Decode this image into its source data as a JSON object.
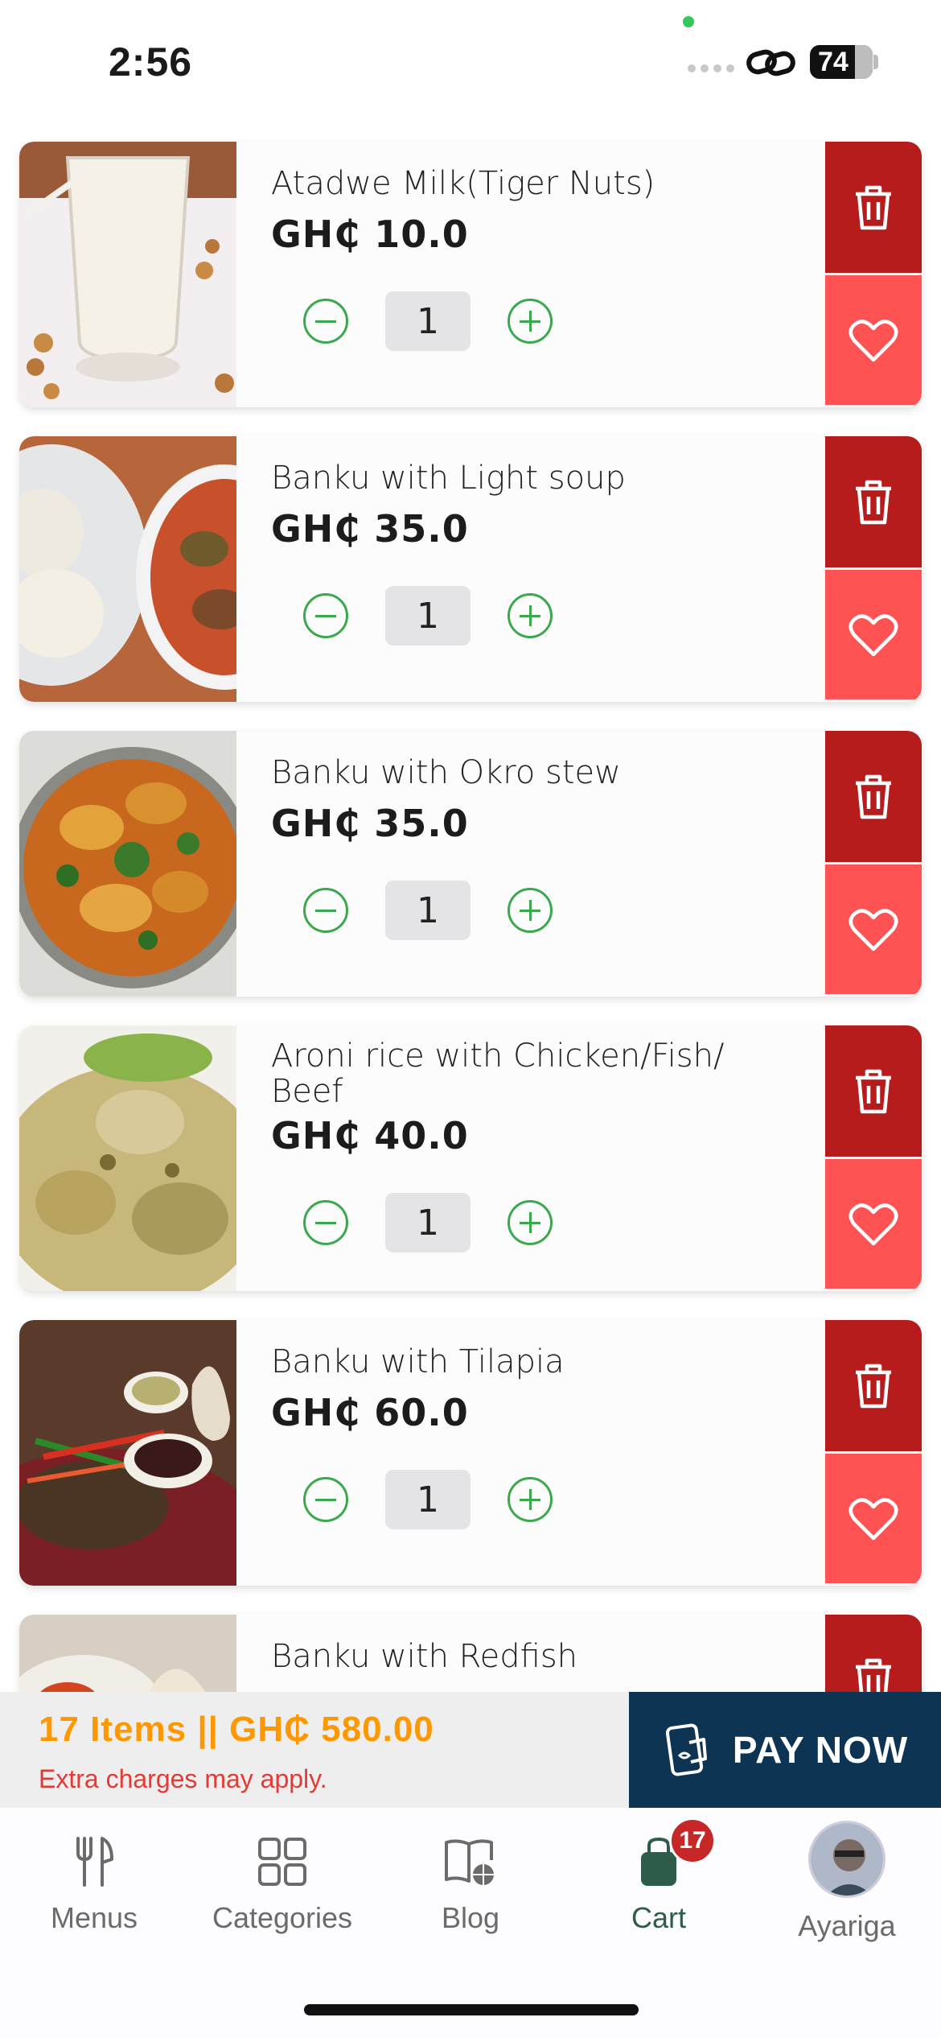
{
  "status_bar": {
    "time": "2:56",
    "battery": "74"
  },
  "cart": {
    "items": [
      {
        "name": "Atadwe Milk(Tiger Nuts)",
        "price": "GH₵ 10.0",
        "quantity": "1"
      },
      {
        "name": "Banku with Light soup",
        "price": "GH₵ 35.0",
        "quantity": "1"
      },
      {
        "name": "Banku with Okro stew",
        "price": "GH₵ 35.0",
        "quantity": "1"
      },
      {
        "name": "Aroni rice with Chicken/Fish/ Beef",
        "price": "GH₵ 40.0",
        "quantity": "1"
      },
      {
        "name": "Banku with Tilapia",
        "price": "GH₵ 60.0",
        "quantity": "1"
      },
      {
        "name": "Banku with Redfish"
      }
    ]
  },
  "checkout": {
    "summary": "17 Items || GH₵ 580.00",
    "note": "Extra charges may apply.",
    "pay_label": "PAY NOW"
  },
  "nav": {
    "menus": "Menus",
    "categories": "Categories",
    "blog": "Blog",
    "cart": "Cart",
    "cart_badge": "17",
    "profile": "Ayariga"
  },
  "colors": {
    "delete": "#b71c1c",
    "favorite": "#ff5252",
    "quantity_accent": "#3aa84c",
    "summary_text": "#ff9800",
    "note_text": "#e53935",
    "pay_button": "#0e3453"
  }
}
